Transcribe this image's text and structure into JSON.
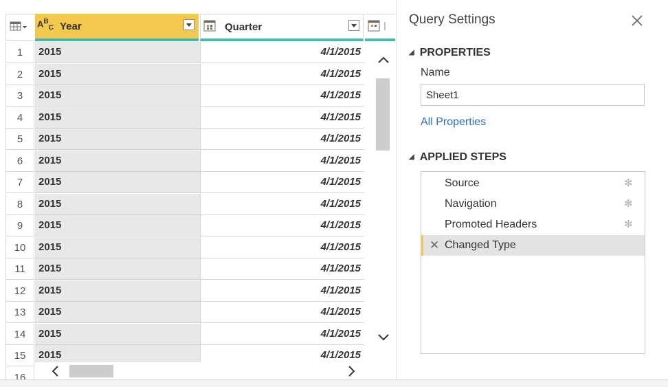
{
  "grid": {
    "columns": [
      {
        "name": "Year",
        "type_icon": "abc-123-type-icon"
      },
      {
        "name": "Quarter",
        "type_icon": "calendar-type-icon"
      }
    ],
    "rows": [
      {
        "num": "1",
        "year": "2015",
        "quarter": "4/1/2015"
      },
      {
        "num": "2",
        "year": "2015",
        "quarter": "4/1/2015"
      },
      {
        "num": "3",
        "year": "2015",
        "quarter": "4/1/2015"
      },
      {
        "num": "4",
        "year": "2015",
        "quarter": "4/1/2015"
      },
      {
        "num": "5",
        "year": "2015",
        "quarter": "4/1/2015"
      },
      {
        "num": "6",
        "year": "2015",
        "quarter": "4/1/2015"
      },
      {
        "num": "7",
        "year": "2015",
        "quarter": "4/1/2015"
      },
      {
        "num": "8",
        "year": "2015",
        "quarter": "4/1/2015"
      },
      {
        "num": "9",
        "year": "2015",
        "quarter": "4/1/2015"
      },
      {
        "num": "10",
        "year": "2015",
        "quarter": "4/1/2015"
      },
      {
        "num": "11",
        "year": "2015",
        "quarter": "4/1/2015"
      },
      {
        "num": "12",
        "year": "2015",
        "quarter": "4/1/2015"
      },
      {
        "num": "13",
        "year": "2015",
        "quarter": "4/1/2015"
      },
      {
        "num": "14",
        "year": "2015",
        "quarter": "4/1/2015"
      },
      {
        "num": "15",
        "year": "2015",
        "quarter": "4/1/2015"
      },
      {
        "num": "16",
        "year": "",
        "quarter": ""
      }
    ]
  },
  "query_settings": {
    "title": "Query Settings",
    "close_icon": "close-icon",
    "properties_heading": "PROPERTIES",
    "name_label": "Name",
    "name_value": "Sheet1",
    "all_properties_link": "All Properties",
    "applied_steps_heading": "APPLIED STEPS",
    "steps": [
      {
        "label": "Source",
        "has_settings": true,
        "active": false
      },
      {
        "label": "Navigation",
        "has_settings": true,
        "active": false
      },
      {
        "label": "Promoted Headers",
        "has_settings": true,
        "active": false
      },
      {
        "label": "Changed Type",
        "has_settings": false,
        "active": true
      }
    ]
  },
  "colors": {
    "selected_column_header": "#f2c94c",
    "column_quality_bar": "#4bb7ab",
    "selected_column_cells": "#e8e8e8",
    "link": "#2a6fba"
  }
}
